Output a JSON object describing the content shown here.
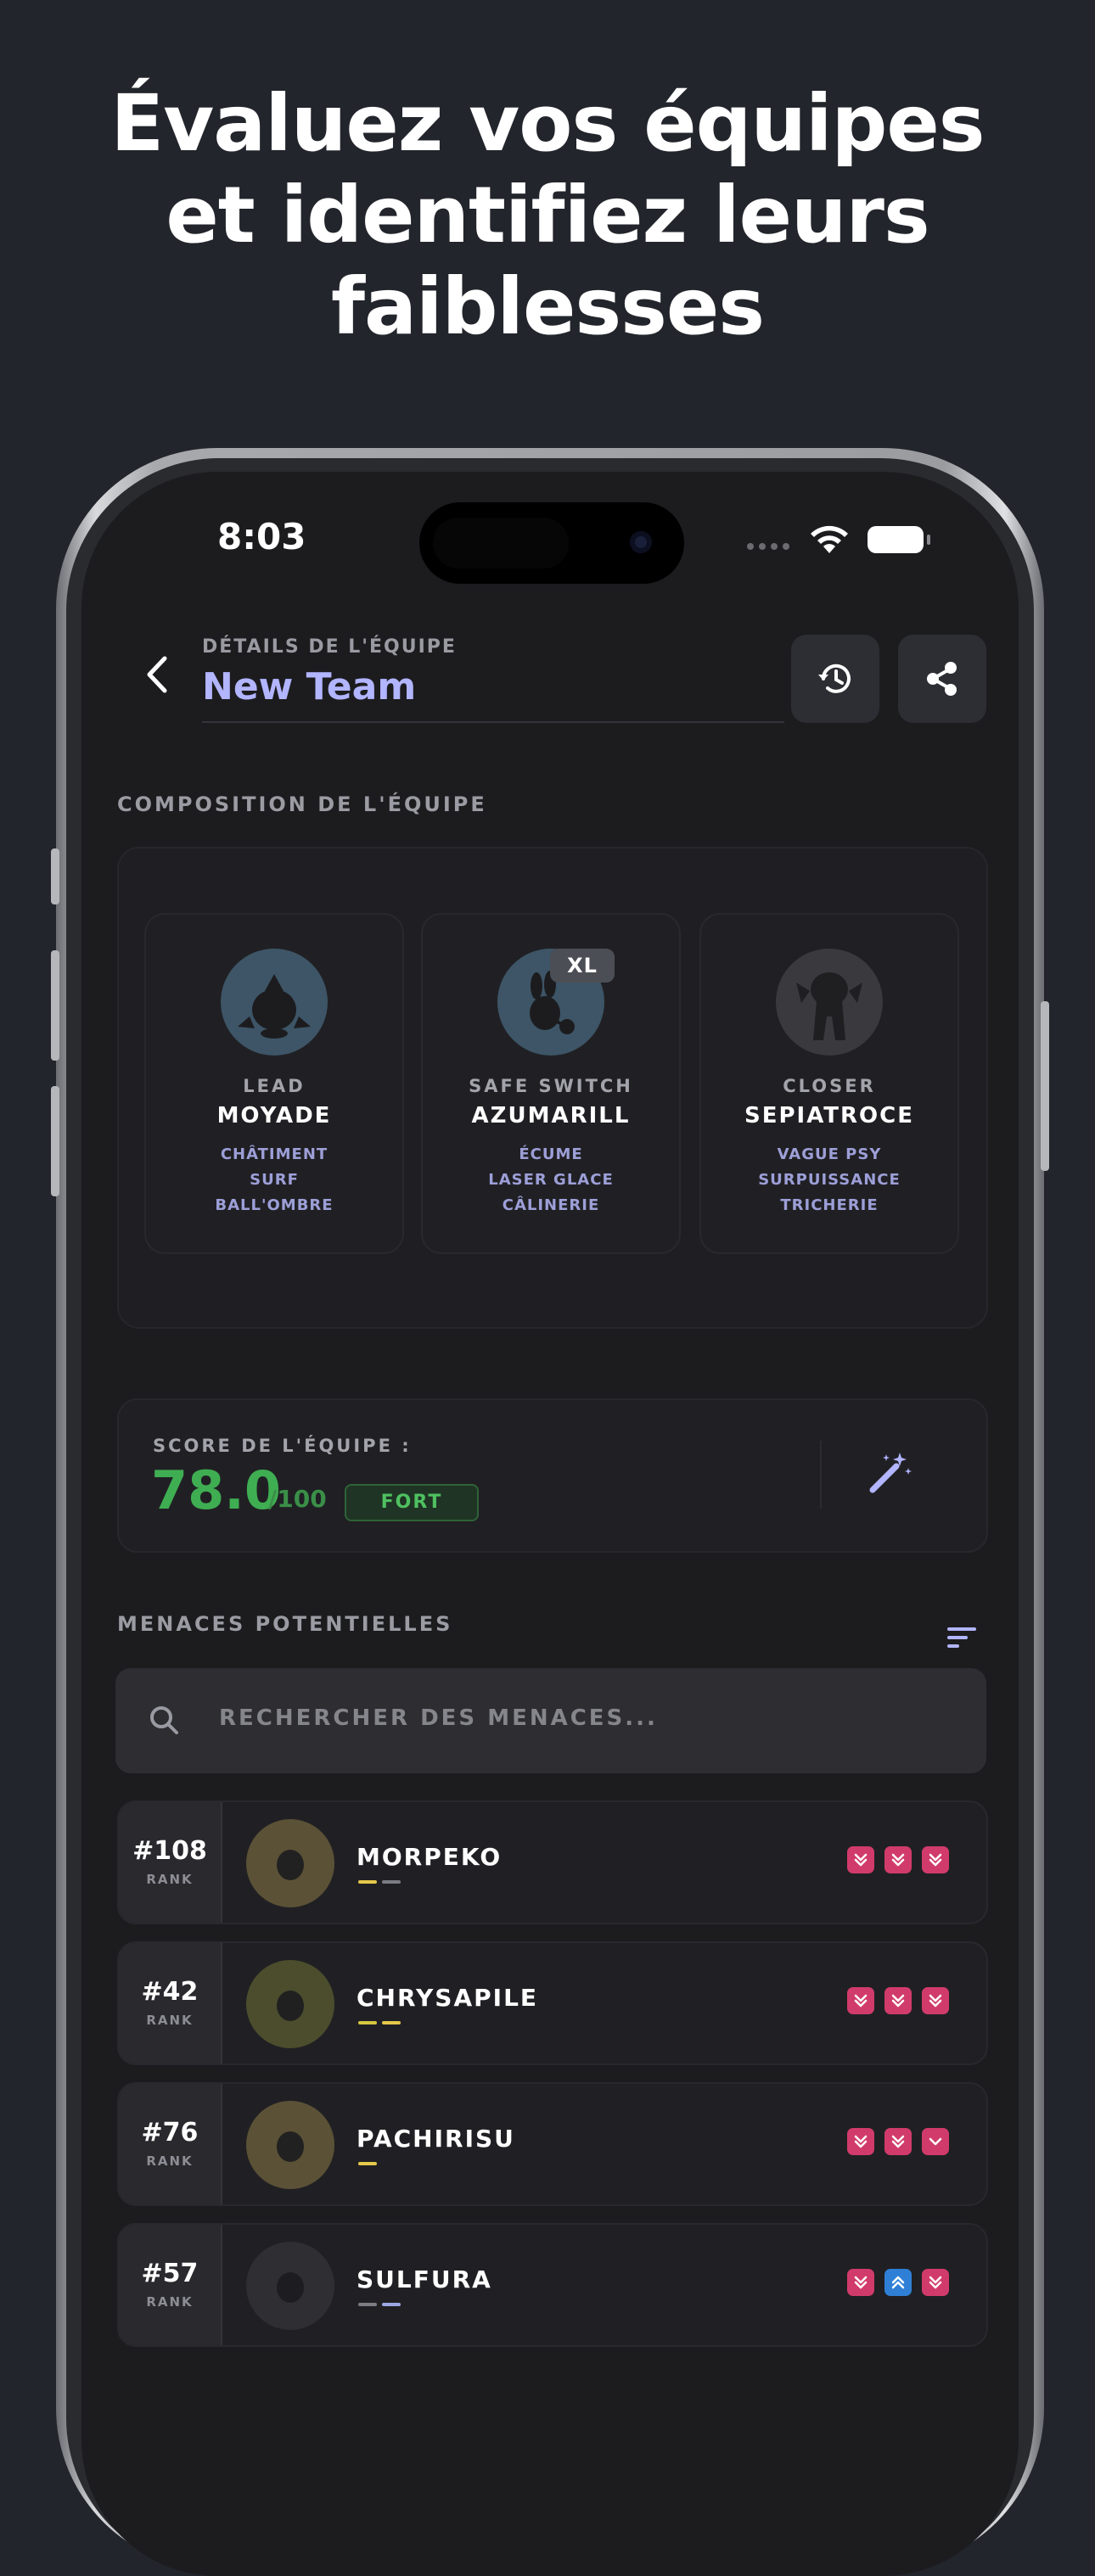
{
  "headline": [
    "Évaluez vos équipes",
    "et identifiez leurs",
    "faiblesses"
  ],
  "status_bar": {
    "time": "8:03"
  },
  "header": {
    "subtitle": "DÉTAILS DE L'ÉQUIPE",
    "title": "New Team"
  },
  "composition": {
    "label": "COMPOSITION DE L'ÉQUIPE",
    "members": [
      {
        "role": "LEAD",
        "name": "MOYADE",
        "moves": [
          "CHÂTIMENT",
          "SURF",
          "BALL'OMBRE"
        ],
        "color": "#3d5566"
      },
      {
        "role": "SAFE SWITCH",
        "name": "AZUMARILL",
        "moves": [
          "ÉCUME",
          "LASER GLACE",
          "CÂLINERIE"
        ],
        "color": "#3d5566",
        "badge": "XL"
      },
      {
        "role": "CLOSER",
        "name": "SEPIATROCE",
        "moves": [
          "VAGUE PSY",
          "SURPUISSANCE",
          "TRICHERIE"
        ],
        "color": "#3a3a3e"
      }
    ]
  },
  "score": {
    "label": "SCORE DE L'ÉQUIPE :",
    "value": "78.0",
    "max": "/100",
    "rating": "FORT"
  },
  "threats": {
    "label": "MENACES POTENTIELLES",
    "search_placeholder": "RECHERCHER DES MENACES...",
    "rank_label": "RANK",
    "items": [
      {
        "rank": "#108",
        "name": "MORPEKO",
        "avatar_color": "#5b5136",
        "bars": [
          "#e6c84a",
          "#7c7c84"
        ],
        "chips": [
          "down",
          "down",
          "down"
        ]
      },
      {
        "rank": "#42",
        "name": "CHRYSAPILE",
        "avatar_color": "#4b4d2d",
        "bars": [
          "#d5c840",
          "#e6c84a"
        ],
        "chips": [
          "down",
          "down",
          "down"
        ]
      },
      {
        "rank": "#76",
        "name": "PACHIRISU",
        "avatar_color": "#5b5136",
        "bars": [
          "#e6c84a"
        ],
        "chips": [
          "down",
          "down",
          "down-single"
        ]
      },
      {
        "rank": "#57",
        "name": "SULFURA",
        "avatar_color": "#2e2e33",
        "bars": [
          "#7c7c84",
          "#9ca8e6"
        ],
        "chips": [
          "down",
          "up",
          "down"
        ]
      }
    ]
  },
  "colors": {
    "accent": "#b2b5ff",
    "score_green": "#3fae52",
    "weak_chip": "#d13b6b",
    "strong_chip": "#2f7fd6"
  }
}
